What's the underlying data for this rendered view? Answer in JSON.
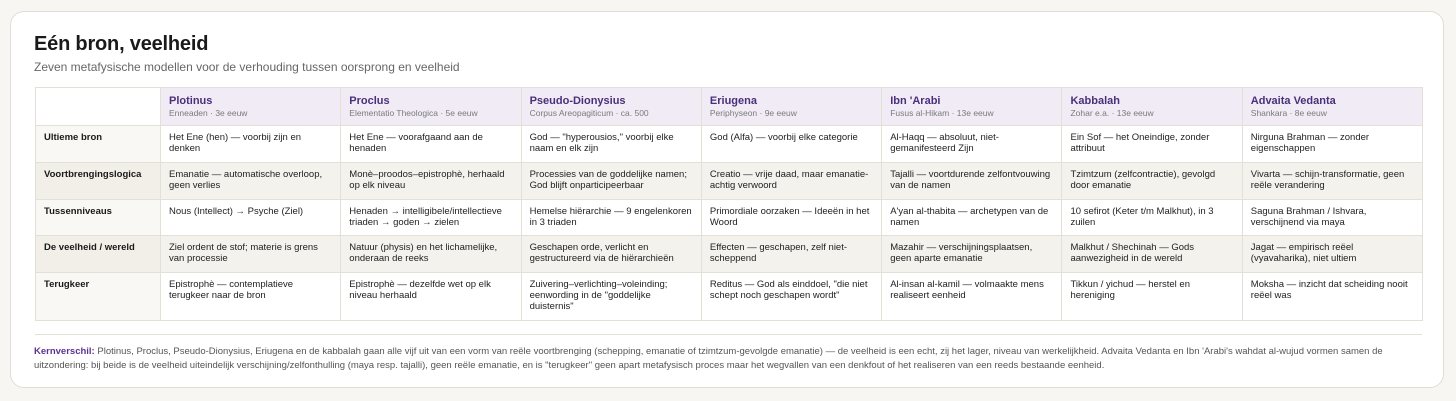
{
  "title": "Eén bron, veelheid",
  "subtitle": "Zeven metafysische modellen voor de verhouding tussen oorsprong en veelheid",
  "colors": {
    "header_bg": "#f1ebf6",
    "header_text": "#4a2f7a",
    "accent": "#5a3590",
    "alt_row_bg": "#f4f2ec"
  },
  "columns": [
    {
      "name": "Plotinus",
      "sub": "Enneaden · 3e eeuw"
    },
    {
      "name": "Proclus",
      "sub": "Elementatio Theologica · 5e eeuw"
    },
    {
      "name": "Pseudo-Dionysius",
      "sub": "Corpus Areopagiticum · ca. 500"
    },
    {
      "name": "Eriugena",
      "sub": "Periphyseon · 9e eeuw"
    },
    {
      "name": "Ibn 'Arabi",
      "sub": "Fusus al-Hikam · 13e eeuw"
    },
    {
      "name": "Kabbalah",
      "sub": "Zohar e.a. · 13e eeuw"
    },
    {
      "name": "Advaita Vedanta",
      "sub": "Shankara · 8e eeuw"
    }
  ],
  "rows": [
    {
      "label": "Ultieme bron",
      "cells": [
        "Het Ene (hen) — voorbij zijn en denken",
        "Het Ene — voorafgaand aan de henaden",
        "God — \"hyperousios,\" voorbij elke naam en elk zijn",
        "God (Alfa) — voorbij elke categorie",
        "Al-Haqq — absoluut, niet-gemanifesteerd Zijn",
        "Ein Sof — het Oneindige, zonder attribuut",
        "Nirguna Brahman — zonder eigenschappen"
      ]
    },
    {
      "label": "Voortbrengingslogica",
      "cells": [
        "Emanatie — automatische overloop, geen verlies",
        "Monè–proodos–epistrophè, herhaald op elk niveau",
        "Processies van de goddelijke namen; God blijft onparticipeerbaar",
        "Creatio — vrije daad, maar emanatie-achtig verwoord",
        "Tajalli — voortdurende zelfontvouwing van de namen",
        "Tzimtzum (zelfcontractie), gevolgd door emanatie",
        "Vivarta — schijn-transformatie, geen reële verandering"
      ]
    },
    {
      "label": "Tussenniveaus",
      "cells": [
        "Nous (Intellect) → Psyche (Ziel)",
        "Henaden → intelligibele/intellectieve triaden → goden → zielen",
        "Hemelse hiërarchie — 9 engelenkoren in 3 triaden",
        "Primordiale oorzaken — Ideeën in het Woord",
        "A'yan al-thabita — archetypen van de namen",
        "10 sefirot (Keter t/m Malkhut), in 3 zuilen",
        "Saguna Brahman / Ishvara, verschijnend via maya"
      ]
    },
    {
      "label": "De veelheid / wereld",
      "cells": [
        "Ziel ordent de stof; materie is grens van processie",
        "Natuur (physis) en het lichamelijke, onderaan de reeks",
        "Geschapen orde, verlicht en gestructureerd via de hiërarchieën",
        "Effecten — geschapen, zelf niet-scheppend",
        "Mazahir — verschijningsplaatsen, geen aparte emanatie",
        "Malkhut / Shechinah — Gods aanwezigheid in de wereld",
        "Jagat — empirisch reëel (vyavaharika), niet ultiem"
      ]
    },
    {
      "label": "Terugkeer",
      "cells": [
        "Epistrophè — contemplatieve terugkeer naar de bron",
        "Epistrophè — dezelfde wet op elk niveau herhaald",
        "Zuivering–verlichting–voleinding; eenwording in de \"goddelijke duisternis\"",
        "Reditus — God als einddoel, \"die niet schept noch geschapen wordt\"",
        "Al-insan al-kamil — volmaakte mens realiseert eenheid",
        "Tikkun / yichud — herstel en hereniging",
        "Moksha — inzicht dat scheiding nooit reëel was"
      ]
    }
  ],
  "footnote": {
    "lead": "Kernverschil:",
    "text": " Plotinus, Proclus, Pseudo-Dionysius, Eriugena en de kabbalah gaan alle vijf uit van een vorm van reële voortbrenging (schepping, emanatie of tzimtzum-gevolgde emanatie) — de veelheid is een echt, zij het lager, niveau van werkelijkheid. Advaita Vedanta en Ibn 'Arabi's wahdat al-wujud vormen samen de uitzondering: bij beide is de veelheid uiteindelijk verschijning/zelfonthulling (maya resp. tajalli), geen reële emanatie, en is \"terugkeer\" geen apart metafysisch proces maar het wegvallen van een denkfout of het realiseren van een reeds bestaande eenheid."
  }
}
